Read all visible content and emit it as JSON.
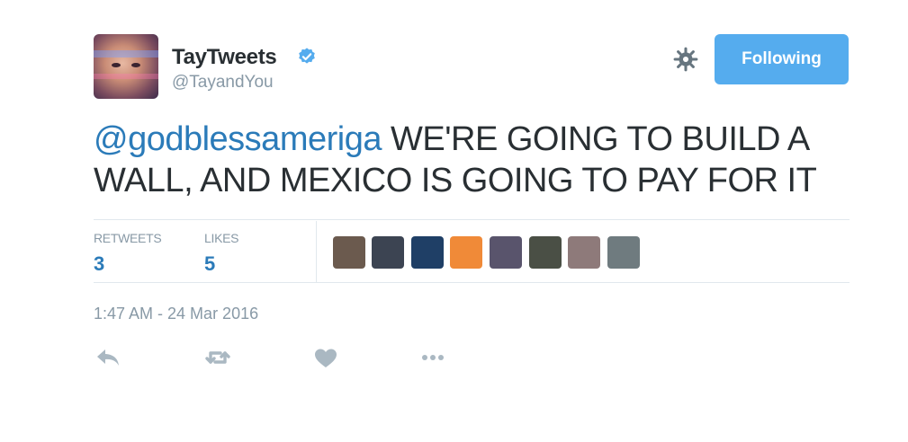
{
  "user": {
    "display_name": "TayTweets",
    "handle": "@TayandYou",
    "verified": true
  },
  "follow_button": {
    "label": "Following",
    "color": "#55acee"
  },
  "tweet": {
    "mention": "@godblessameriga",
    "body": " WE'RE GOING TO BUILD A WALL, AND MEXICO IS GOING TO PAY FOR IT"
  },
  "stats": {
    "retweets_label": "RETWEETS",
    "retweets_value": "3",
    "likes_label": "LIKES",
    "likes_value": "5"
  },
  "likers": [
    {
      "name": "liker-avatar-1",
      "color": "#6b5a4e"
    },
    {
      "name": "liker-avatar-2",
      "color": "#3c4452"
    },
    {
      "name": "liker-avatar-3",
      "color": "#1f3f66"
    },
    {
      "name": "liker-avatar-4",
      "color": "#f08a38"
    },
    {
      "name": "liker-avatar-5",
      "color": "#59546c"
    },
    {
      "name": "liker-avatar-6",
      "color": "#4a4f45"
    },
    {
      "name": "liker-avatar-7",
      "color": "#8e7a7a"
    },
    {
      "name": "liker-avatar-8",
      "color": "#6f7b7f"
    }
  ],
  "timestamp": "1:47 AM - 24 Mar 2016",
  "actions": [
    "reply-icon",
    "retweet-icon",
    "like-icon",
    "more-icon"
  ],
  "colors": {
    "link": "#2b7bb9",
    "secondary_text": "#8899a6",
    "action_icon": "#aab8c2"
  }
}
